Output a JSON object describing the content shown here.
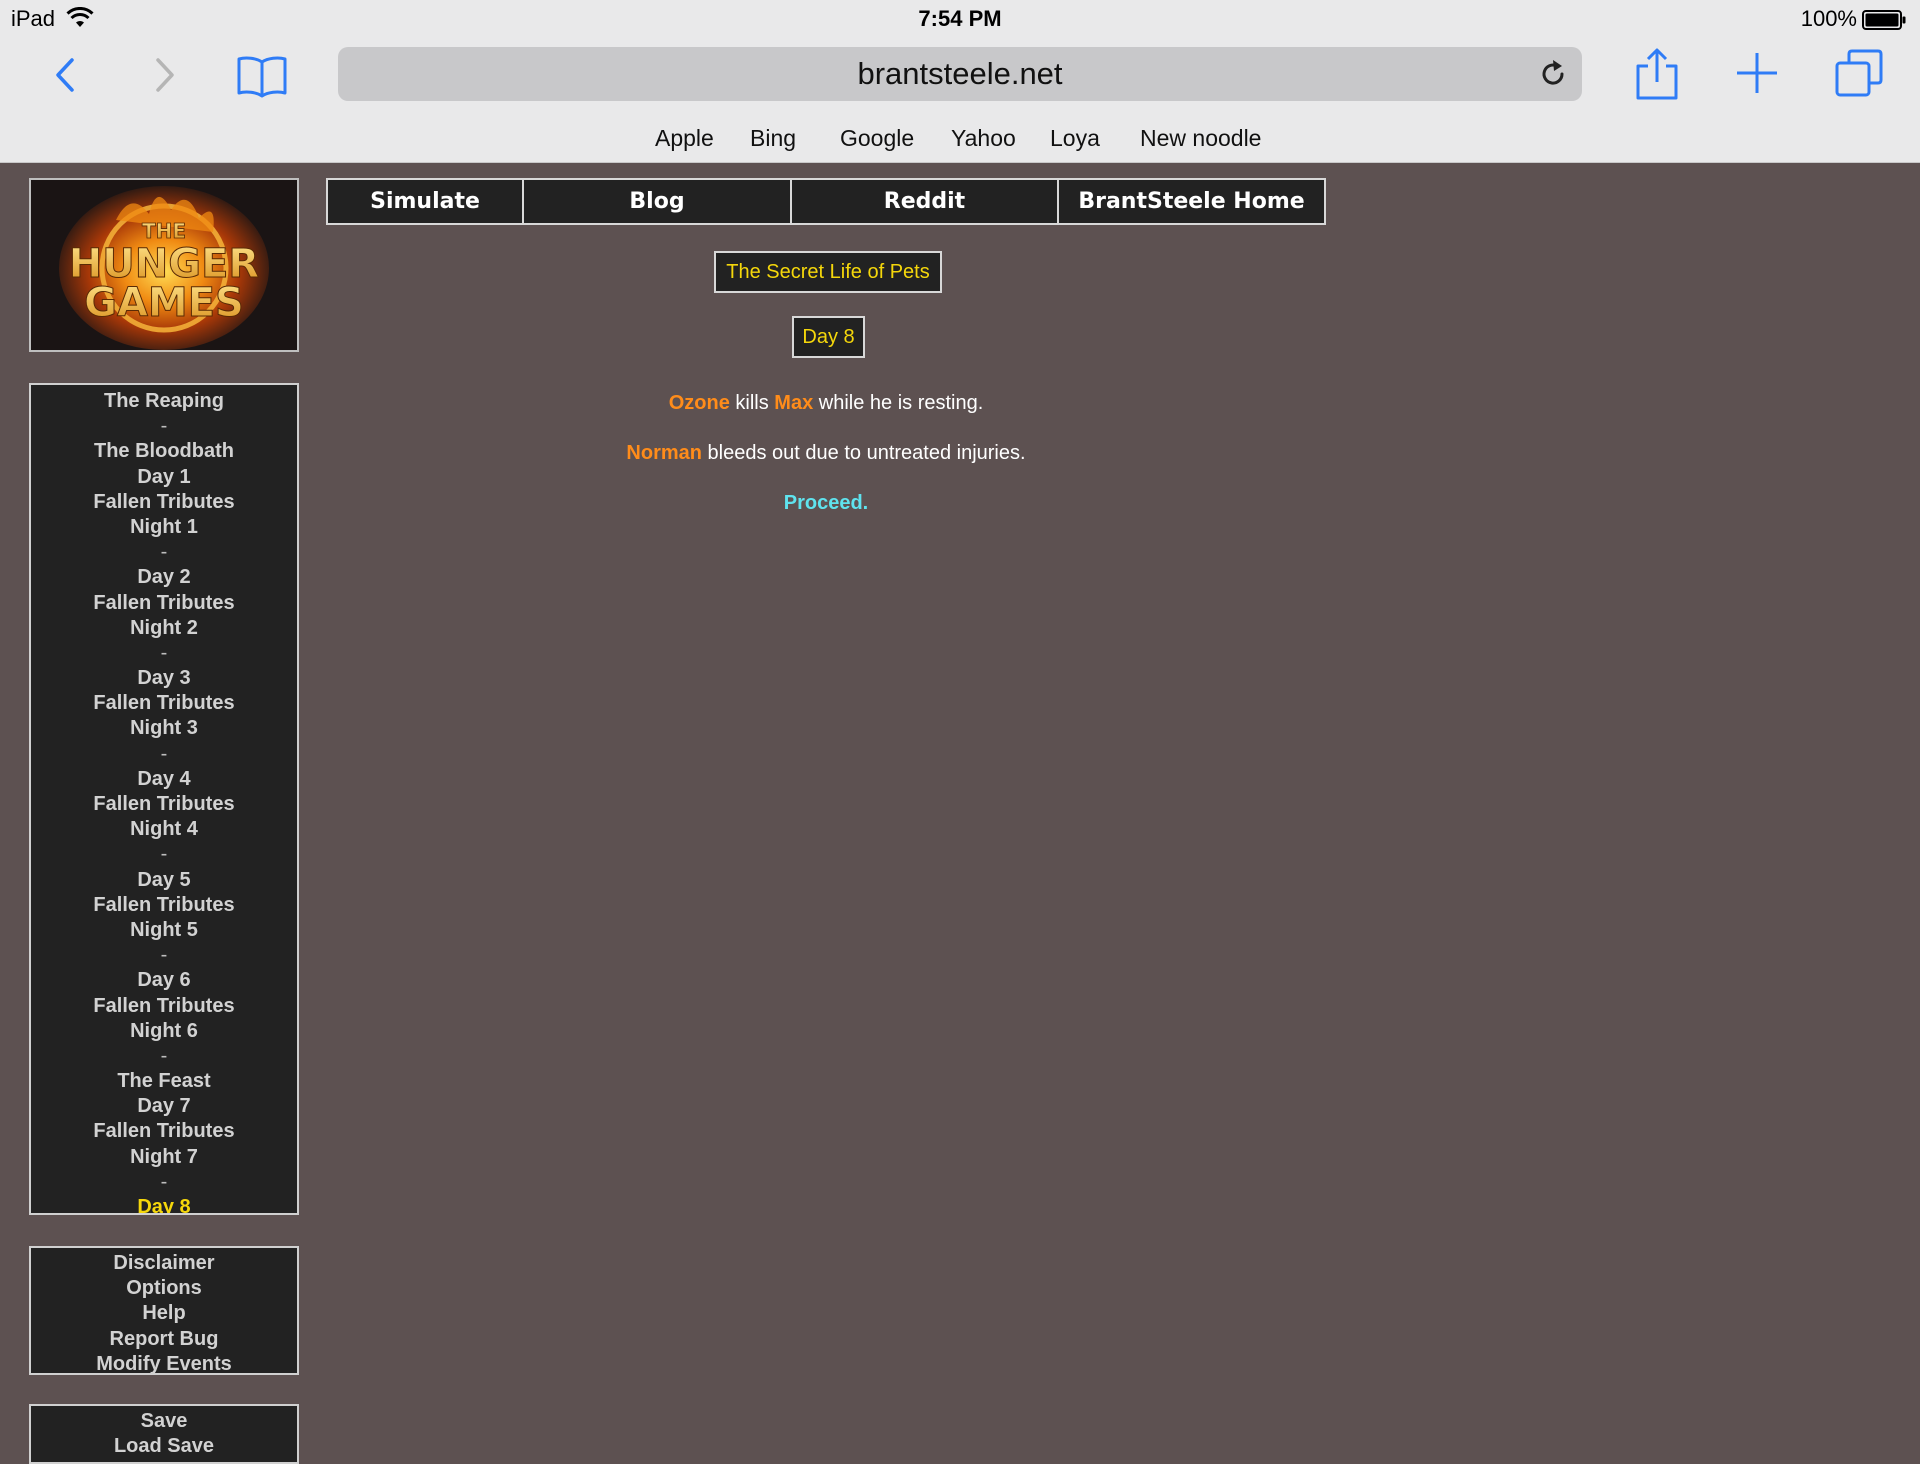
{
  "status_bar": {
    "device": "iPad",
    "time": "7:54 PM",
    "battery": "100%"
  },
  "browser": {
    "url": "brantsteele.net",
    "favorites": [
      "Apple",
      "Bing",
      "Google",
      "Yahoo",
      "Loya",
      "New noodle"
    ]
  },
  "top_nav": [
    "Simulate",
    "Blog",
    "Reddit",
    "BrantSteele Home"
  ],
  "logo": {
    "line1": "THE",
    "line2": "HUNGER",
    "line3": "GAMES"
  },
  "season_title": "The Secret Life of Pets",
  "day_label": "Day 8",
  "events": [
    {
      "actor": "Ozone",
      "verb": " kills ",
      "target": "Max",
      "rest": " while he is resting."
    },
    {
      "actor": "Norman",
      "rest": " bleeds out due to untreated injuries."
    }
  ],
  "proceed_label": "Proceed.",
  "sidebar": {
    "nav": [
      "The Reaping",
      "-",
      "The Bloodbath",
      "Day 1",
      "Fallen Tributes",
      "Night 1",
      "-",
      "Day 2",
      "Fallen Tributes",
      "Night 2",
      "-",
      "Day 3",
      "Fallen Tributes",
      "Night 3",
      "-",
      "Day 4",
      "Fallen Tributes",
      "Night 4",
      "-",
      "Day 5",
      "Fallen Tributes",
      "Night 5",
      "-",
      "Day 6",
      "Fallen Tributes",
      "Night 6",
      "-",
      "The Feast",
      "Day 7",
      "Fallen Tributes",
      "Night 7",
      "-",
      "Day 8"
    ],
    "current": "Day 8",
    "links": [
      "Disclaimer",
      "Options",
      "Help",
      "Report Bug",
      "Modify Events"
    ],
    "save": [
      "Save",
      "Load Save"
    ]
  },
  "colors": {
    "background": "#5d5151",
    "panel": "#222222",
    "highlight": "#f5d70b",
    "tribute": "#ff8c1a",
    "proceed": "#5fe3ee"
  }
}
